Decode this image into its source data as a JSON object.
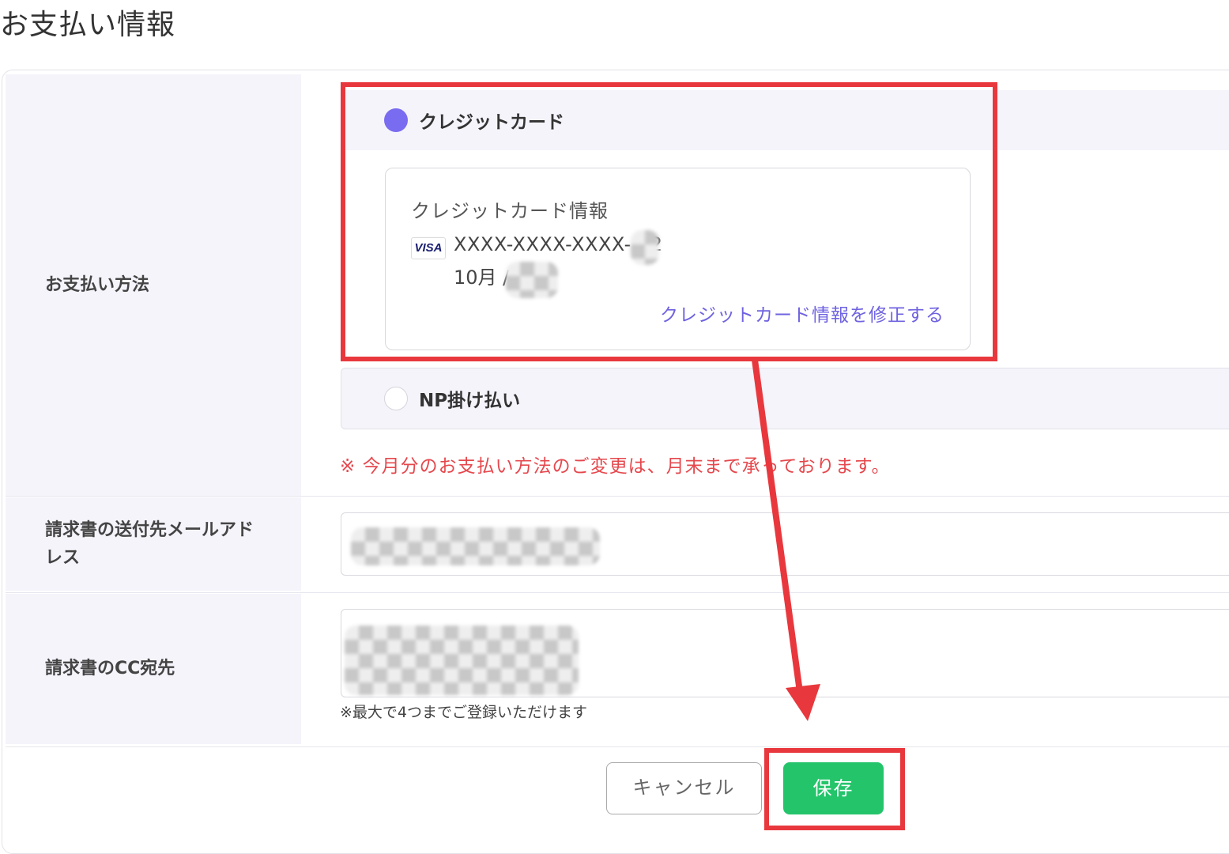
{
  "page": {
    "title": "お支払い情報"
  },
  "payment_method": {
    "label": "お支払い方法",
    "options": [
      {
        "label": "クレジットカード",
        "selected": true
      },
      {
        "label": "NP掛け払い",
        "selected": false
      }
    ],
    "credit_card": {
      "heading": "クレジットカード情報",
      "brand": "VISA",
      "number": "XXXX-XXXX-XXXX-  42",
      "expiry": "10月 /",
      "edit_link": "クレジットカード情報を修正する"
    },
    "notice": "※ 今月分のお支払い方法のご変更は、月末まで承っております。"
  },
  "invoice_email": {
    "label": "請求書の送付先メールアドレス",
    "value_redacted": true
  },
  "invoice_cc": {
    "label": "請求書のCC宛先",
    "value_redacted": true,
    "hint": "※最大で4つまでご登録いただけます"
  },
  "actions": {
    "cancel": "キャンセル",
    "save": "保存"
  },
  "colors": {
    "accent": "#7a6cf0",
    "save_button": "#24c46b",
    "notice": "#e5484d",
    "annotation": "#e8383d"
  }
}
